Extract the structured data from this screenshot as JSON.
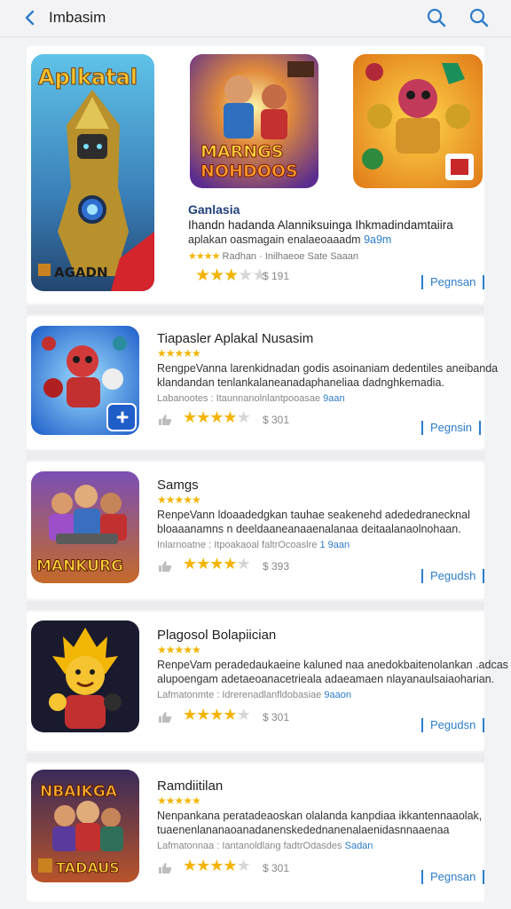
{
  "header": {
    "title": "Imbasim",
    "icons": [
      "back-icon",
      "search-icon",
      "search-icon"
    ]
  },
  "featured": {
    "items": [
      {
        "art_text": "Aplkatal",
        "badge_text": "AGADN"
      },
      {
        "art_text_line1": "MARNGS",
        "art_text_line2": "NOHDOOS"
      },
      {
        "art_text": ""
      }
    ],
    "title": "Ganlasia",
    "desc_line1": "Ihandn hadanda Alanniksuinga Ihkmadindamtaiira",
    "desc_line2": "aplakan oasmagain enalaeoaaadm",
    "desc_link": "9a9m",
    "meta": "Radhan · Inilhaeoe Sate Saaan",
    "meta_stars": "★★★★",
    "rating": 3,
    "price": "$ 191",
    "button": "Pegnsan"
  },
  "apps": [
    {
      "title": "Tiapasler Aplakal Nusasim",
      "stars": "★★★★★",
      "desc1": "RengpeVanna larenkidnadan godis asoinaniam dedentiles aneibanda",
      "desc2": "klandandan tenlankalaneanadaphaneliaa dadnghkemadia.",
      "meta": "Labanootes : Itaunnanolnlantpooasae",
      "meta_link": "9aan",
      "rating": 4,
      "price": "$ 301",
      "button": "Pegnsin",
      "icon": "robot-hero-icon"
    },
    {
      "title": "Samgs",
      "stars": "★★★★★",
      "desc1": "RenpeVann ldoaadedgkan tauhae seakenehd adededranecknal",
      "desc2": "bloaaanamns n deeldaaneanaaenalanaa deitaalanaolnohaan.",
      "meta": "Inlarnoatne : Itpoakaoal faltrOcoaslre",
      "meta_link": "1 9aan",
      "rating": 4,
      "price": "$ 393",
      "button": "Pegudsh",
      "icon": "heroes-squad-icon",
      "art_text": "MANKURG"
    },
    {
      "title": "Plagosol Bolapiician",
      "stars": "★★★★★",
      "desc1": "RenpeVam peradedaukaeine kaluned naa anedokbaitenolankan .adcas",
      "desc2": "alupoengam adetaeoanacetrieala adaeamaen nlayanaulsaiaoharian.",
      "meta": "Lafmatonmte : Idrerenadlanfldobasiae",
      "meta_link": "9aaon",
      "rating": 4,
      "price": "$ 301",
      "button": "Pegudsn",
      "icon": "flame-warrior-icon"
    },
    {
      "title": "Ramdiitilan",
      "stars": "★★★★★",
      "desc1": "Nenpankana peratadeaoskan olalanda kanpdiaa ikkantennaaolak,",
      "desc2": "tuaenenlananaoanadanenskedednanenalaenidasnnaaenaa",
      "meta": "Lafmatonnaa : Iantanoldlang fadtrOdasdes",
      "meta_link": "Sadan",
      "rating": 4,
      "price": "$ 301",
      "button": "Pegnsan",
      "icon": "adventure-party-icon",
      "art_text": "NBAIKGA",
      "art_text2": "TADAUS"
    }
  ],
  "colors": {
    "accent": "#2c7cc9",
    "star": "#f4b400",
    "title_blue": "#1f3f7a"
  }
}
